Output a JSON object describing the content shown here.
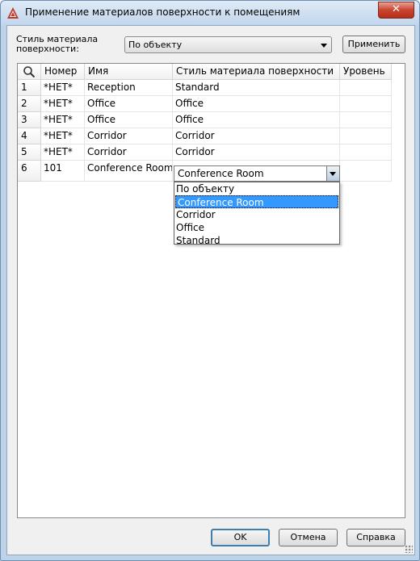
{
  "window": {
    "title": "Применение материалов поверхности к помещениям",
    "close_label": "✕"
  },
  "controls": {
    "style_label": "Стиль материала поверхности:",
    "style_value": "По объекту",
    "apply_button": "Применить"
  },
  "grid": {
    "search_icon": "magnifier-icon",
    "columns": [
      "Номер",
      "Имя",
      "Стиль материала поверхности",
      "Уровень"
    ],
    "rows": [
      {
        "index": "1",
        "number": "*НЕТ*",
        "name": "Reception",
        "style": "Standard",
        "level": ""
      },
      {
        "index": "2",
        "number": "*НЕТ*",
        "name": "Office",
        "style": "Office",
        "level": ""
      },
      {
        "index": "3",
        "number": "*НЕТ*",
        "name": "Office",
        "style": "Office",
        "level": ""
      },
      {
        "index": "4",
        "number": "*НЕТ*",
        "name": "Corridor",
        "style": "Corridor",
        "level": ""
      },
      {
        "index": "5",
        "number": "*НЕТ*",
        "name": "Corridor",
        "style": "Corridor",
        "level": ""
      },
      {
        "index": "6",
        "number": "101",
        "name": "Conference Room",
        "style": "Conference Room",
        "level": ""
      }
    ],
    "editor_value": "Conference Room",
    "dropdown_options": [
      "По объекту",
      "Conference Room",
      "Corridor",
      "Office",
      "Standard"
    ],
    "dropdown_selected_index": 1
  },
  "footer": {
    "ok": "OK",
    "cancel": "Отмена",
    "help": "Справка"
  },
  "colors": {
    "selection": "#3399ff",
    "close_button": "#c8452f",
    "default_button_border": "#3c7fb1"
  }
}
